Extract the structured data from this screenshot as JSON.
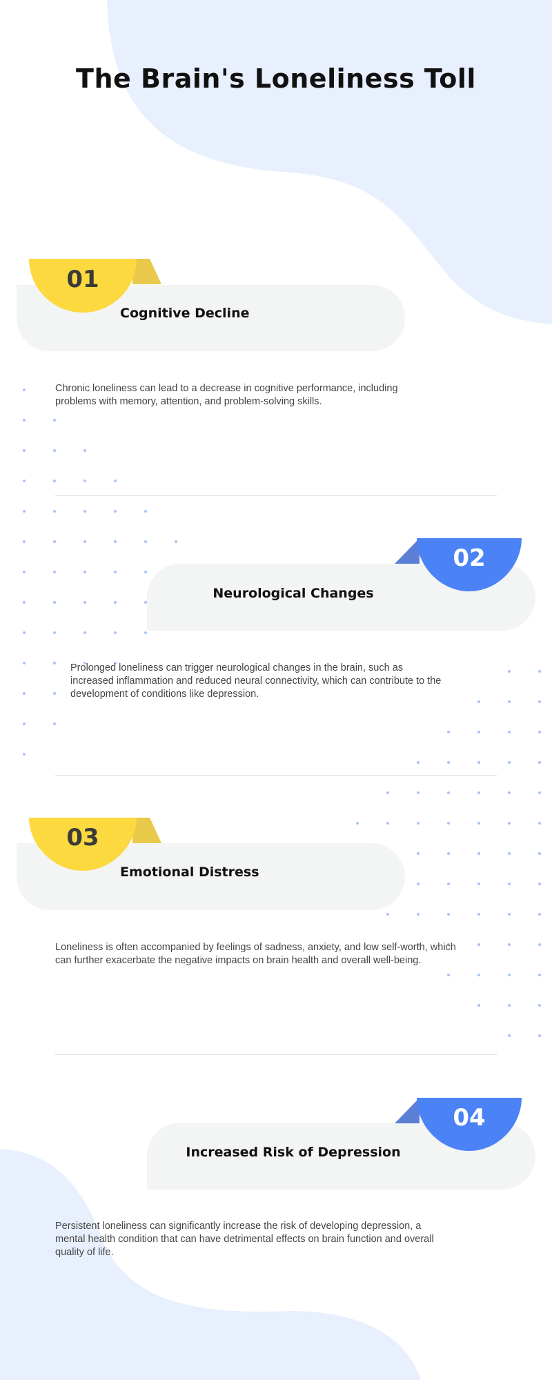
{
  "page": {
    "title": "The Brain's Loneliness Toll"
  },
  "colors": {
    "yellow": "#fcd93f",
    "yellow_flap": "#e8c94a",
    "blue": "#4b82f5",
    "blue_flap": "#5b7fd4",
    "blob": "#e8effd",
    "dots": "#8bb0ef"
  },
  "sections": [
    {
      "number": "01",
      "heading": "Cognitive Decline",
      "text": "Chronic loneliness can lead to a decrease in cognitive performance, including problems with memory, attention, and problem-solving skills."
    },
    {
      "number": "02",
      "heading": "Neurological Changes",
      "text": "Prolonged loneliness can trigger neurological changes in the brain, such as increased inflammation and reduced neural connectivity, which can contribute to the development of conditions like depression."
    },
    {
      "number": "03",
      "heading": "Emotional Distress",
      "text": "Loneliness is often accompanied by feelings of sadness, anxiety, and low self-worth, which can further exacerbate the negative impacts on brain health and overall well-being."
    },
    {
      "number": "04",
      "heading": "Increased Risk of Depression",
      "text": "Persistent loneliness can significantly increase the risk of developing depression, a mental health condition that can have detrimental effects on brain function and overall quality of life."
    }
  ]
}
